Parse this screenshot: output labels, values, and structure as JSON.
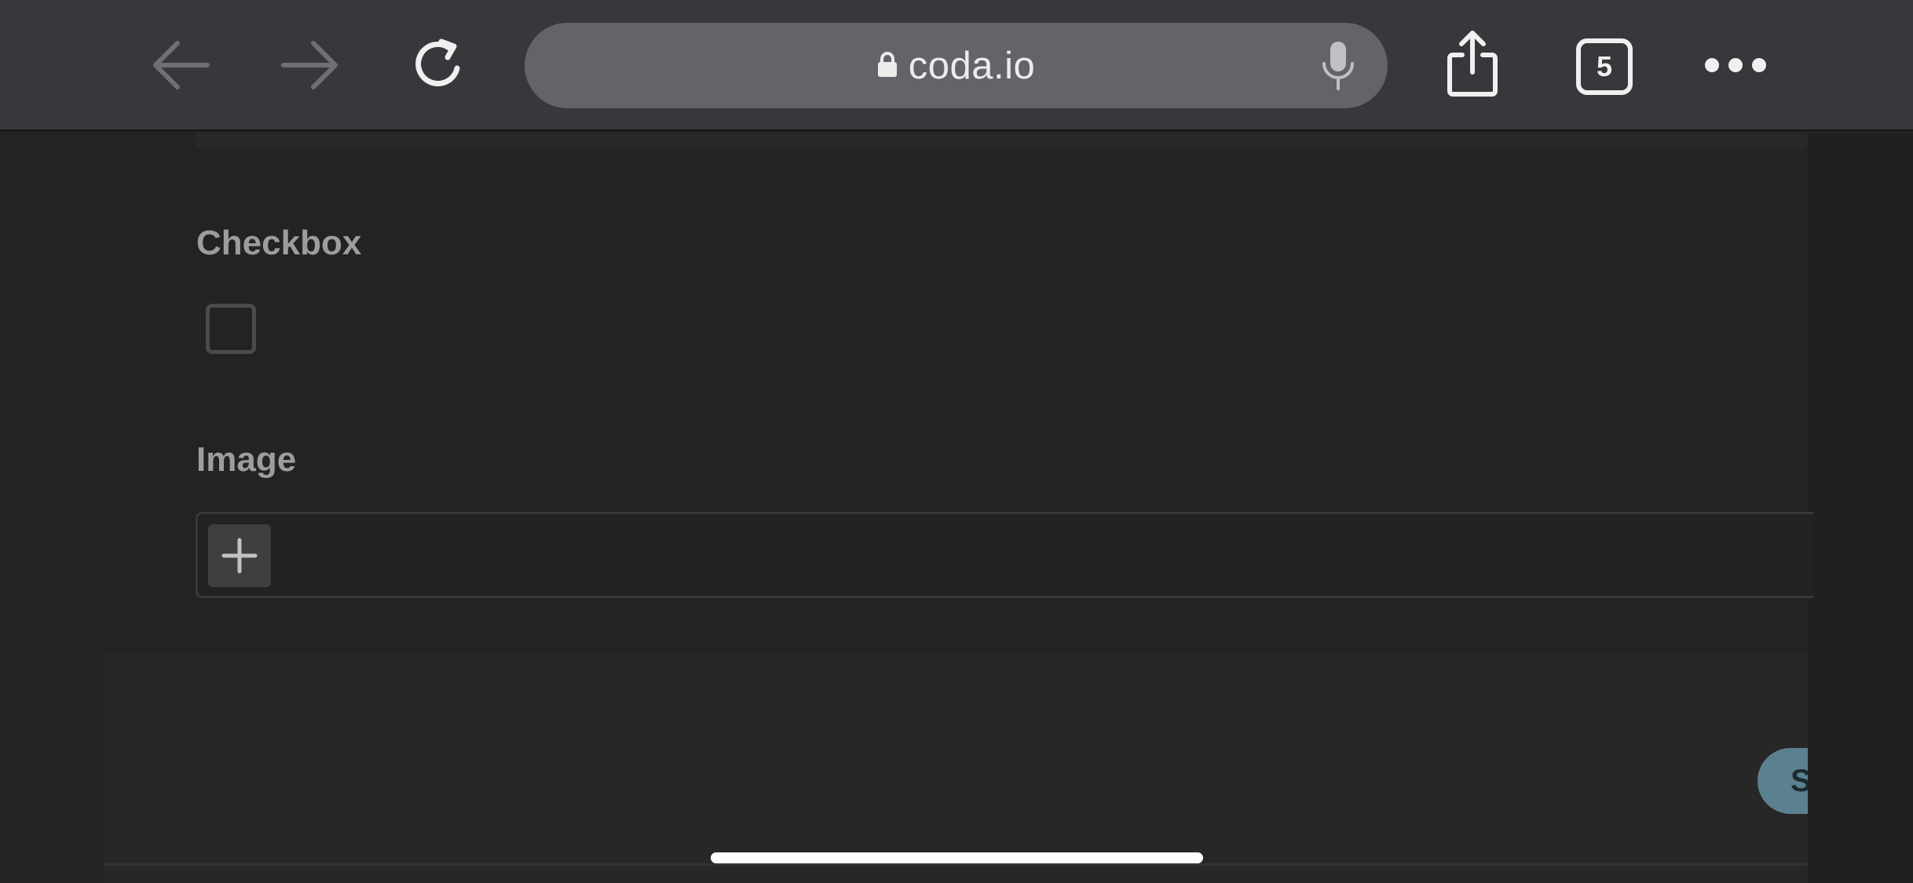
{
  "browser": {
    "url": "coda.io",
    "tab_count": "5",
    "icons": {
      "back": "arrow-left-icon",
      "forward": "arrow-right-icon",
      "reload": "reload-icon",
      "lock": "lock-icon",
      "mic": "microphone-icon",
      "share": "share-icon",
      "tabs": "tabs-icon",
      "more": "more-dots-icon"
    }
  },
  "form": {
    "checkbox_field": {
      "label": "Checkbox",
      "checked": false
    },
    "image_field": {
      "label": "Image",
      "add_icon": "plus-icon"
    },
    "submit_label": "S"
  },
  "colors": {
    "toolbar_bg": "#37383b",
    "url_bar_bg": "#626469",
    "page_bg": "#232323",
    "label_text": "#9d9d9d",
    "submit_bg": "#5b8190"
  }
}
